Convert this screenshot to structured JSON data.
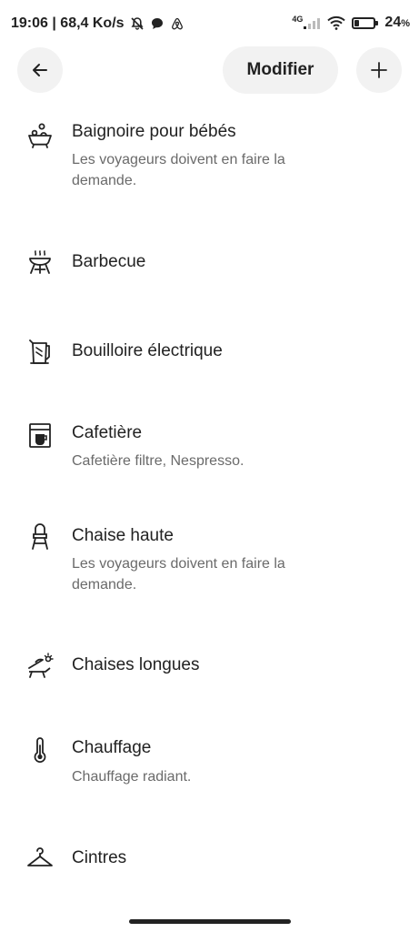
{
  "status_bar": {
    "time_speed": "19:06 | 68,4 Ko/s",
    "network": "4G",
    "battery": "24",
    "battery_unit": "%",
    "battery_level": 0.24
  },
  "header": {
    "edit_label": "Modifier"
  },
  "amenities": [
    {
      "title": "Baignoire pour bébés",
      "desc_line1": "Les voyageurs doivent en faire la",
      "desc_line2": "demande.",
      "icon": "baby-bath-icon"
    },
    {
      "title": "Barbecue",
      "icon": "barbecue-icon"
    },
    {
      "title": "Bouilloire électrique",
      "icon": "electric-kettle-icon"
    },
    {
      "title": "Cafetière",
      "desc_line1": "Cafetière filtre, Nespresso.",
      "icon": "coffee-maker-icon"
    },
    {
      "title": "Chaise haute",
      "desc_line1": "Les voyageurs doivent en faire la",
      "desc_line2": "demande.",
      "icon": "high-chair-icon"
    },
    {
      "title": "Chaises longues",
      "icon": "sun-lounger-icon"
    },
    {
      "title": "Chauffage",
      "desc_line1": "Chauffage radiant.",
      "icon": "thermometer-icon"
    },
    {
      "title": "Cintres",
      "icon": "hanger-icon"
    }
  ]
}
